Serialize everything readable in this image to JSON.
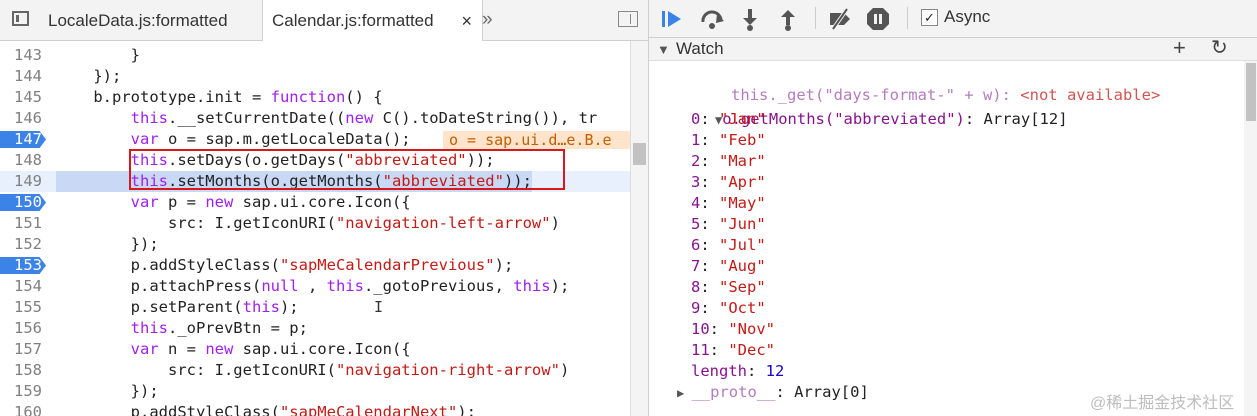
{
  "editor": {
    "tabs": [
      {
        "label": "LocaleData.js:formatted"
      },
      {
        "label": "Calendar.js:formatted",
        "close": "×"
      }
    ],
    "more_tabs": "»",
    "lines": [
      {
        "num": "143",
        "text": "        }"
      },
      {
        "num": "144",
        "text": "    });"
      },
      {
        "num": "145",
        "text": "    b.prototype.init = function() {"
      },
      {
        "num": "146",
        "text": "        this.__setCurrentDate((new C().toDateString()), tr"
      },
      {
        "num": "147",
        "text": "        var o = sap.m.getLocaleData();",
        "annotation": "o = sap.ui.d…e.B.e"
      },
      {
        "num": "148",
        "text": "        this.setDays(o.getDays(\"abbreviated\"));"
      },
      {
        "num": "149",
        "text": "        this.setMonths(o.getMonths(\"abbreviated\"));"
      },
      {
        "num": "150",
        "text": "        var p = new sap.ui.core.Icon({"
      },
      {
        "num": "151",
        "text": "            src: I.getIconURI(\"navigation-left-arrow\")"
      },
      {
        "num": "152",
        "text": "        });"
      },
      {
        "num": "153",
        "text": "        p.addStyleClass(\"sapMeCalendarPrevious\");"
      },
      {
        "num": "154",
        "text": "        p.attachPress(null , this._gotoPrevious, this);"
      },
      {
        "num": "155",
        "text": "        p.setParent(this);"
      },
      {
        "num": "156",
        "text": "        this._oPrevBtn = p;"
      },
      {
        "num": "157",
        "text": "        var n = new sap.ui.core.Icon({"
      },
      {
        "num": "158",
        "text": "            src: I.getIconURI(\"navigation-right-arrow\")"
      },
      {
        "num": "159",
        "text": "        });"
      },
      {
        "num": "160",
        "text": "        p.addStyleClass(\"sapMeCalendarNext\");"
      }
    ],
    "breakpoints": [
      "147",
      "150",
      "153"
    ],
    "current_line": "149"
  },
  "debugger": {
    "async_label": "Async",
    "async_checked": "✓",
    "watch_title": "Watch",
    "add_label": "+",
    "refresh_label": "↻",
    "entries": {
      "expr1": "this._get(\"days-format-\" + w)",
      "expr1_value": "<not available>",
      "expr2": "o.getMonths(\"abbreviated\")",
      "expr2_value": "Array[12]",
      "items": [
        {
          "key": "0",
          "value": "\"Jan\""
        },
        {
          "key": "1",
          "value": "\"Feb\""
        },
        {
          "key": "2",
          "value": "\"Mar\""
        },
        {
          "key": "3",
          "value": "\"Apr\""
        },
        {
          "key": "4",
          "value": "\"May\""
        },
        {
          "key": "5",
          "value": "\"Jun\""
        },
        {
          "key": "6",
          "value": "\"Jul\""
        },
        {
          "key": "7",
          "value": "\"Aug\""
        },
        {
          "key": "8",
          "value": "\"Sep\""
        },
        {
          "key": "9",
          "value": "\"Oct\""
        },
        {
          "key": "10",
          "value": "\"Nov\""
        },
        {
          "key": "11",
          "value": "\"Dec\""
        }
      ],
      "length_key": "length",
      "length_value": "12",
      "proto_key": "__proto__",
      "proto_value": "Array[0]"
    }
  },
  "watermark": "@稀土掘金技术社区",
  "colors": {
    "breakpoint": "#3b83e6",
    "highlight_box": "#d7191c",
    "keyword": "#a020f0",
    "string": "#c41a16"
  }
}
